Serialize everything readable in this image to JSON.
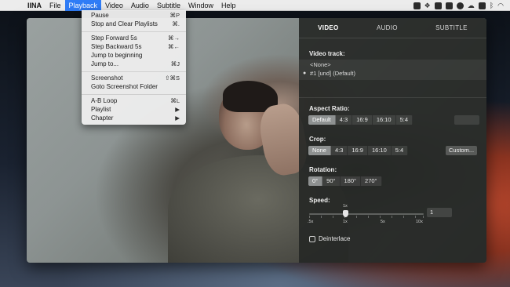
{
  "menubar": {
    "apple": "",
    "app_name": "IINA",
    "items": [
      "File",
      "Playback",
      "Video",
      "Audio",
      "Subtitle",
      "Window",
      "Help"
    ],
    "active": "Playback",
    "status_icons": [
      "photo-icon",
      "dropbox-icon",
      "screenshot-icon",
      "evernote-icon",
      "password-icon",
      "cloud-icon",
      "drive-icon",
      "bluetooth-icon",
      "wifi-icon"
    ]
  },
  "playback_menu": {
    "items": [
      {
        "label": "Pause",
        "shortcut": "⌘P"
      },
      {
        "label": "Stop and Clear Playlists",
        "shortcut": "⌘."
      },
      {
        "label": "Step Forward 5s",
        "shortcut": "⌘→"
      },
      {
        "label": "Step Backward 5s",
        "shortcut": "⌘←"
      },
      {
        "label": "Jump to beginning",
        "shortcut": ""
      },
      {
        "label": "Jump to...",
        "shortcut": "⌘J"
      },
      {
        "label": "Screenshot",
        "shortcut": "⇧⌘S"
      },
      {
        "label": "Goto Screenshot Folder",
        "shortcut": ""
      },
      {
        "label": "A-B Loop",
        "shortcut": "⌘L"
      },
      {
        "label": "Playlist",
        "shortcut": "▶"
      },
      {
        "label": "Chapter",
        "shortcut": "▶"
      }
    ]
  },
  "panel": {
    "tabs": [
      "VIDEO",
      "AUDIO",
      "SUBTITLE"
    ],
    "selected_tab": "VIDEO",
    "video_track": {
      "label": "Video track:",
      "tracks": [
        "<None>",
        "#1 [und] (Default)"
      ],
      "selected_bullet": "●"
    },
    "aspect": {
      "label": "Aspect Ratio:",
      "options": [
        "Default",
        "4:3",
        "16:9",
        "16:10",
        "5:4"
      ],
      "selected": "Default"
    },
    "crop": {
      "label": "Crop:",
      "options": [
        "None",
        "4:3",
        "16:9",
        "16:10",
        "5:4"
      ],
      "selected": "None",
      "custom_label": "Custom..."
    },
    "rotation": {
      "label": "Rotation:",
      "options": [
        "0°",
        "90°",
        "180°",
        "270°"
      ],
      "selected": "0°"
    },
    "speed": {
      "label": "Speed:",
      "value": "1",
      "top_mark": "1x",
      "marks": [
        ".5x",
        "1x",
        "5x",
        "10x"
      ]
    },
    "deinterlace_label": "Deinterlace"
  },
  "colors": {
    "menu_highlight": "#2f7cf6",
    "panel_bg": "#262826",
    "segment_selected": "#8e9191"
  }
}
